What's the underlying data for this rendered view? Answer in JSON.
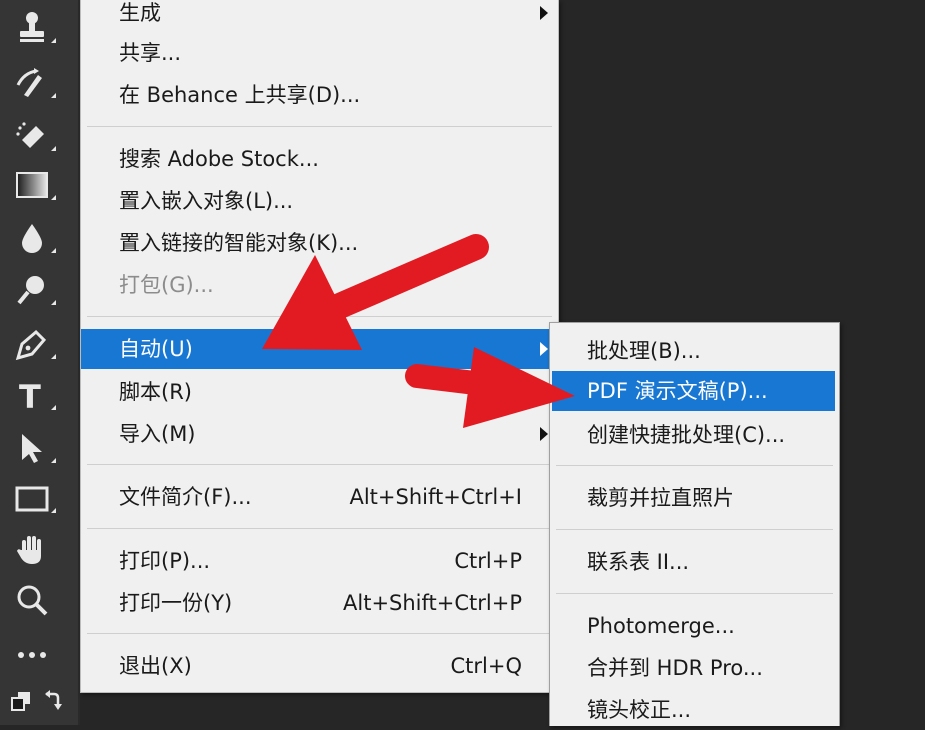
{
  "main_menu": {
    "items": [
      {
        "label": "生成",
        "shortcut": "",
        "submenu": true
      },
      {
        "label": "共享...",
        "shortcut": ""
      },
      {
        "label": "在 Behance 上共享(D)...",
        "shortcut": ""
      },
      {
        "label": "搜索 Adobe Stock...",
        "shortcut": ""
      },
      {
        "label": "置入嵌入对象(L)...",
        "shortcut": ""
      },
      {
        "label": "置入链接的智能对象(K)...",
        "shortcut": ""
      },
      {
        "label": "打包(G)...",
        "shortcut": "",
        "disabled": true
      },
      {
        "label": "自动(U)",
        "shortcut": "",
        "submenu": true,
        "highlighted": true
      },
      {
        "label": "脚本(R)",
        "shortcut": ""
      },
      {
        "label": "导入(M)",
        "shortcut": "",
        "submenu": true
      },
      {
        "label": "文件简介(F)...",
        "shortcut": "Alt+Shift+Ctrl+I"
      },
      {
        "label": "打印(P)...",
        "shortcut": "Ctrl+P"
      },
      {
        "label": "打印一份(Y)",
        "shortcut": "Alt+Shift+Ctrl+P"
      },
      {
        "label": "退出(X)",
        "shortcut": "Ctrl+Q"
      }
    ]
  },
  "auto_submenu": {
    "items": [
      {
        "label": "批处理(B)..."
      },
      {
        "label": "PDF 演示文稿(P)...",
        "highlighted": true
      },
      {
        "label": "创建快捷批处理(C)..."
      },
      {
        "label": "裁剪并拉直照片"
      },
      {
        "label": "联系表 II..."
      },
      {
        "label": "Photomerge..."
      },
      {
        "label": "合并到 HDR Pro..."
      },
      {
        "label": "镜头校正..."
      }
    ]
  },
  "toolbar": {
    "tools": [
      "clone-stamp-icon",
      "history-brush-icon",
      "eraser-icon",
      "gradient-icon",
      "blur-icon",
      "dodge-icon",
      "pen-icon",
      "type-icon",
      "path-selection-icon",
      "rectangle-icon",
      "hand-icon",
      "zoom-icon",
      "more-tools-icon"
    ],
    "type_tool_glyph": "T"
  },
  "colors": {
    "highlight": "#1877d2",
    "menu_bg": "#f0f0f0",
    "annotation_arrow": "#e21b23",
    "toolbar_bg": "#353535"
  }
}
